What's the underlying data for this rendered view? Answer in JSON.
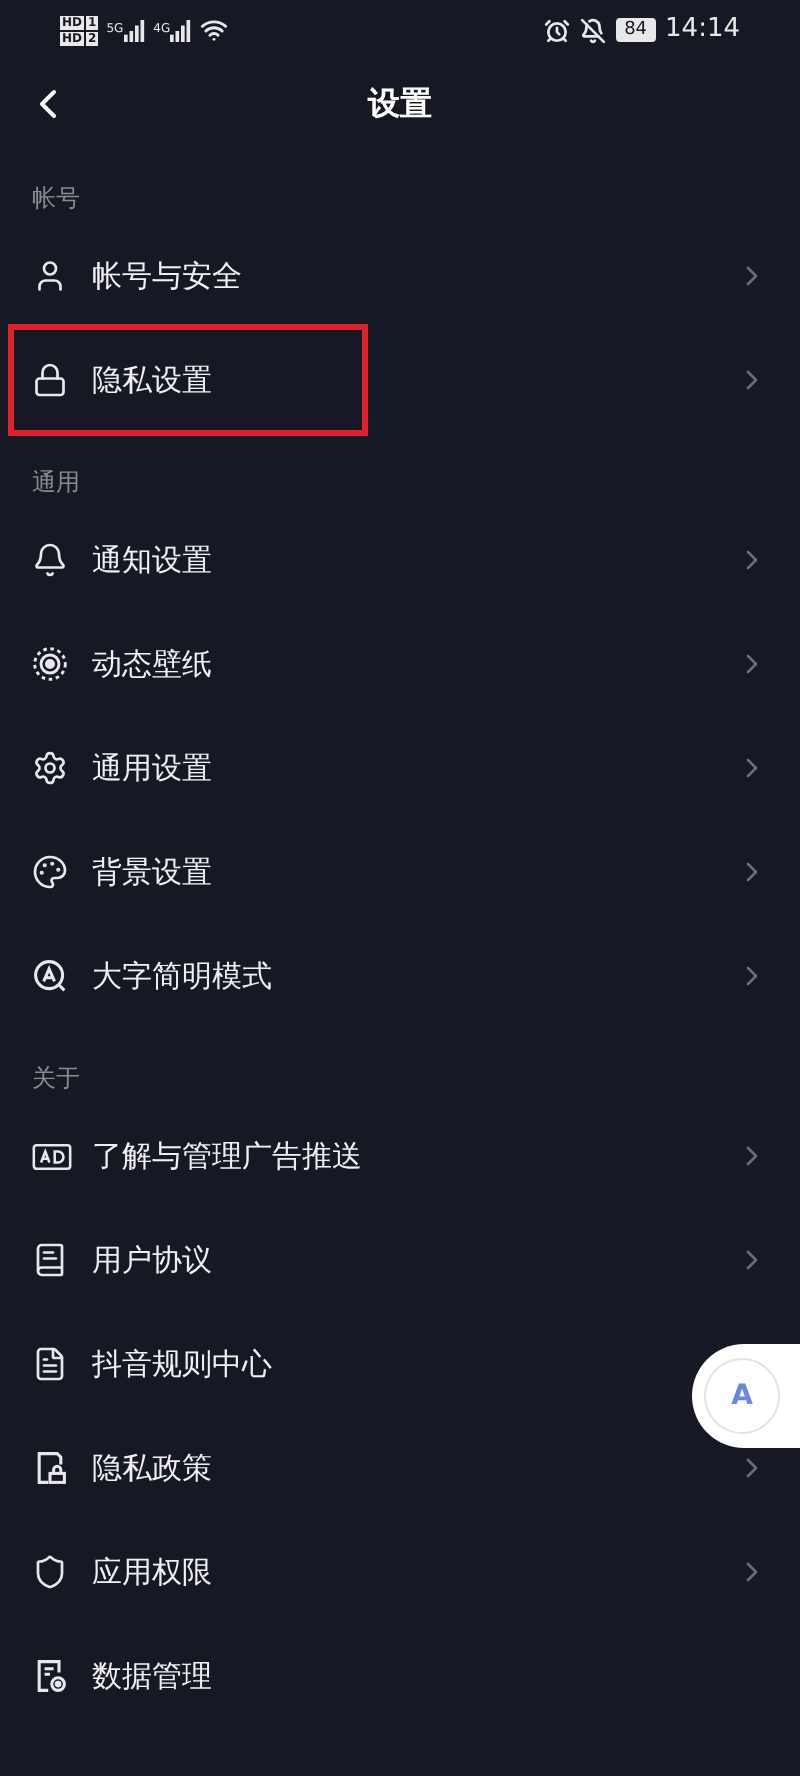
{
  "status_bar": {
    "sim_labels": [
      "HD",
      "HD"
    ],
    "sim_numbers": [
      "1",
      "2"
    ],
    "networks": [
      "5G",
      "4G"
    ],
    "battery": "84",
    "time": "14:14"
  },
  "header": {
    "title": "设置"
  },
  "sections": [
    {
      "title": "帐号",
      "items": [
        {
          "label": "帐号与安全",
          "kind": "user",
          "chevron": true,
          "highlighted": false
        },
        {
          "label": "隐私设置",
          "kind": "lock",
          "chevron": true,
          "highlighted": true
        }
      ]
    },
    {
      "title": "通用",
      "items": [
        {
          "label": "通知设置",
          "kind": "bell",
          "chevron": true,
          "highlighted": false
        },
        {
          "label": "动态壁纸",
          "kind": "target",
          "chevron": true,
          "highlighted": false
        },
        {
          "label": "通用设置",
          "kind": "gear",
          "chevron": true,
          "highlighted": false
        },
        {
          "label": "背景设置",
          "kind": "palette",
          "chevron": true,
          "highlighted": false
        },
        {
          "label": "大字简明模式",
          "kind": "letter",
          "chevron": true,
          "highlighted": false
        }
      ]
    },
    {
      "title": "关于",
      "items": [
        {
          "label": "了解与管理广告推送",
          "kind": "ad",
          "chevron": true,
          "highlighted": false
        },
        {
          "label": "用户协议",
          "kind": "book",
          "chevron": true,
          "highlighted": false
        },
        {
          "label": "抖音规则中心",
          "kind": "doc",
          "chevron": false,
          "highlighted": false
        },
        {
          "label": "隐私政策",
          "kind": "filelock",
          "chevron": true,
          "highlighted": false
        },
        {
          "label": "应用权限",
          "kind": "shield",
          "chevron": true,
          "highlighted": false
        },
        {
          "label": "数据管理",
          "kind": "filegear",
          "chevron": false,
          "highlighted": false
        }
      ]
    }
  ],
  "floating_button": {
    "label": "A"
  }
}
